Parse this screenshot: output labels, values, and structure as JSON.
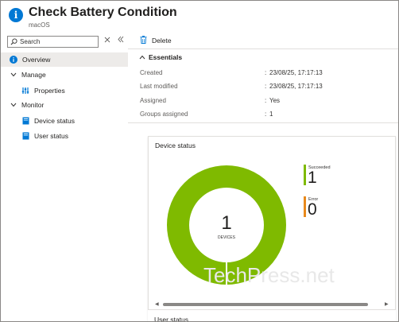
{
  "header": {
    "title": "Check Battery Condition",
    "subtitle": "macOS",
    "more_label": "···"
  },
  "sidebar": {
    "search_placeholder": "Search",
    "items": [
      {
        "label": "Overview",
        "icon": "info-icon",
        "selected": true
      },
      {
        "label": "Manage",
        "icon": "chevron-down-icon"
      },
      {
        "label": "Properties",
        "icon": "properties-icon"
      },
      {
        "label": "Monitor",
        "icon": "chevron-down-icon"
      },
      {
        "label": "Device status",
        "icon": "device-status-icon"
      },
      {
        "label": "User status",
        "icon": "user-status-icon"
      }
    ]
  },
  "toolbar": {
    "delete_label": "Delete"
  },
  "essentials": {
    "heading": "Essentials",
    "rows": [
      {
        "label": "Created",
        "value": "23/08/25, 17:17:13"
      },
      {
        "label": "Last modified",
        "value": "23/08/25, 17:17:13"
      },
      {
        "label": "Assigned",
        "value": "Yes"
      },
      {
        "label": "Groups assigned",
        "value": "1"
      }
    ]
  },
  "device_status_card": {
    "title": "Device status",
    "center_value": "1",
    "center_label": "DEVICES",
    "legend": [
      {
        "label": "Succeeded",
        "value": "1",
        "color": "#7fba00"
      },
      {
        "label": "Error",
        "value": "0",
        "color": "#e8891c"
      }
    ]
  },
  "user_status_card": {
    "title": "User status"
  },
  "watermark": "TechPress.net",
  "colors": {
    "accent": "#0078d4",
    "success": "#7fba00",
    "error": "#e8891c"
  }
}
